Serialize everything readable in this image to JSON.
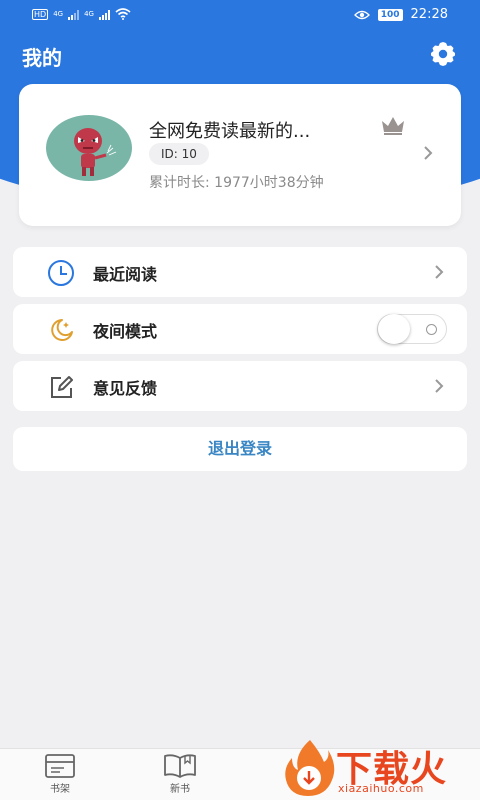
{
  "status_bar": {
    "network": "HD",
    "signal_1": "4G",
    "signal_2": "4G",
    "battery": "100",
    "time": "22:28"
  },
  "header": {
    "title": "我的"
  },
  "profile": {
    "nickname": "全网免费读最新的...",
    "id_text": "ID: 10",
    "duration_text": "累计时长: 1977小时38分钟"
  },
  "menu": {
    "recent_label": "最近阅读",
    "night_label": "夜间模式",
    "feedback_label": "意见反馈",
    "night_mode_on": false
  },
  "logout_label": "退出登录",
  "tabs": [
    {
      "label": "书架",
      "icon": "bookshelf-icon"
    },
    {
      "label": "新书",
      "icon": "open-book-icon"
    }
  ],
  "watermark": {
    "brand": "下载火",
    "url": "xiazaihuo.com"
  },
  "colors": {
    "primary": "#2a77e0",
    "logout_text": "#3a86c4",
    "moon": "#e0a030",
    "watermark": "#e8461e"
  }
}
